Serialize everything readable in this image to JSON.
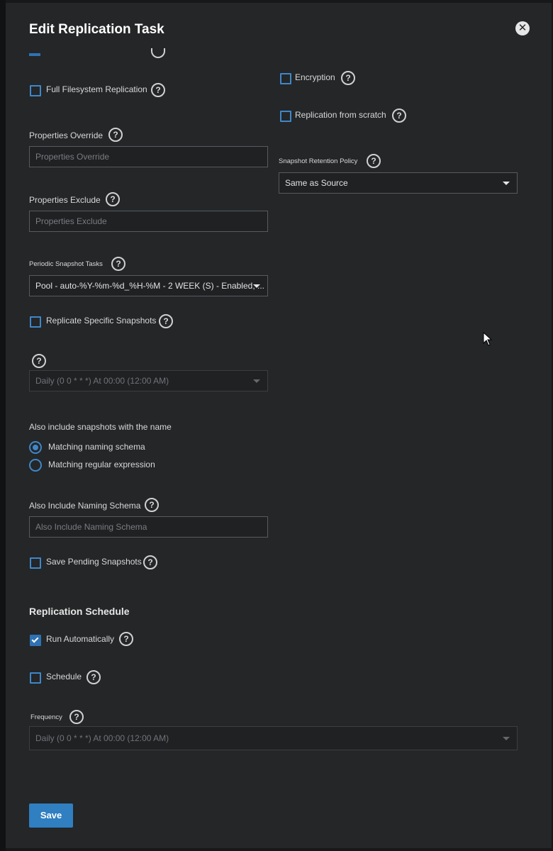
{
  "dialog": {
    "title": "Edit Replication Task",
    "close_icon": "close-icon"
  },
  "options": {
    "full_filesystem_replication": {
      "label": "Full Filesystem Replication",
      "checked": false
    },
    "encryption": {
      "label": "Encryption",
      "checked": false
    },
    "replication_from_scratch": {
      "label": "Replication from scratch",
      "checked": false
    }
  },
  "properties_override": {
    "label": "Properties Override",
    "placeholder": "Properties Override"
  },
  "properties_exclude": {
    "label": "Properties Exclude",
    "placeholder": "Properties Exclude"
  },
  "snapshot_retention_policy": {
    "label": "Snapshot Retention Policy",
    "value": "Same as Source"
  },
  "periodic_snapshot_tasks": {
    "label": "Periodic Snapshot Tasks",
    "value": "Pool - auto-%Y-%m-%d_%H-%M - 2 WEEK (S) - Enabled, ..."
  },
  "replicate_specific_snapshots": {
    "label": "Replicate Specific Snapshots",
    "checked": false
  },
  "snapshot_schedule": {
    "value": "Daily (0 0 * * *)  At 00:00 (12:00 AM)",
    "disabled": true
  },
  "include_snapshots": {
    "label": "Also include snapshots with the name",
    "options": [
      "Matching naming schema",
      "Matching regular expression"
    ],
    "selected": "Matching naming schema"
  },
  "also_include_naming_schema": {
    "label": "Also Include Naming Schema",
    "placeholder": "Also Include Naming Schema"
  },
  "save_pending_snapshots": {
    "label": "Save Pending Snapshots",
    "checked": false
  },
  "replication_schedule": {
    "heading": "Replication Schedule",
    "run_automatically": {
      "label": "Run Automatically",
      "checked": true
    },
    "schedule": {
      "label": "Schedule",
      "checked": false
    },
    "frequency": {
      "label": "Frequency",
      "value": "Daily (0 0 * * *)  At 00:00 (12:00 AM)",
      "disabled": true
    }
  },
  "actions": {
    "save_label": "Save"
  },
  "help_glyph": "?",
  "close_glyph": "✕",
  "colors": {
    "accent": "#2f7fc1",
    "panel": "#242628",
    "checkbox": "#3f87c9"
  }
}
